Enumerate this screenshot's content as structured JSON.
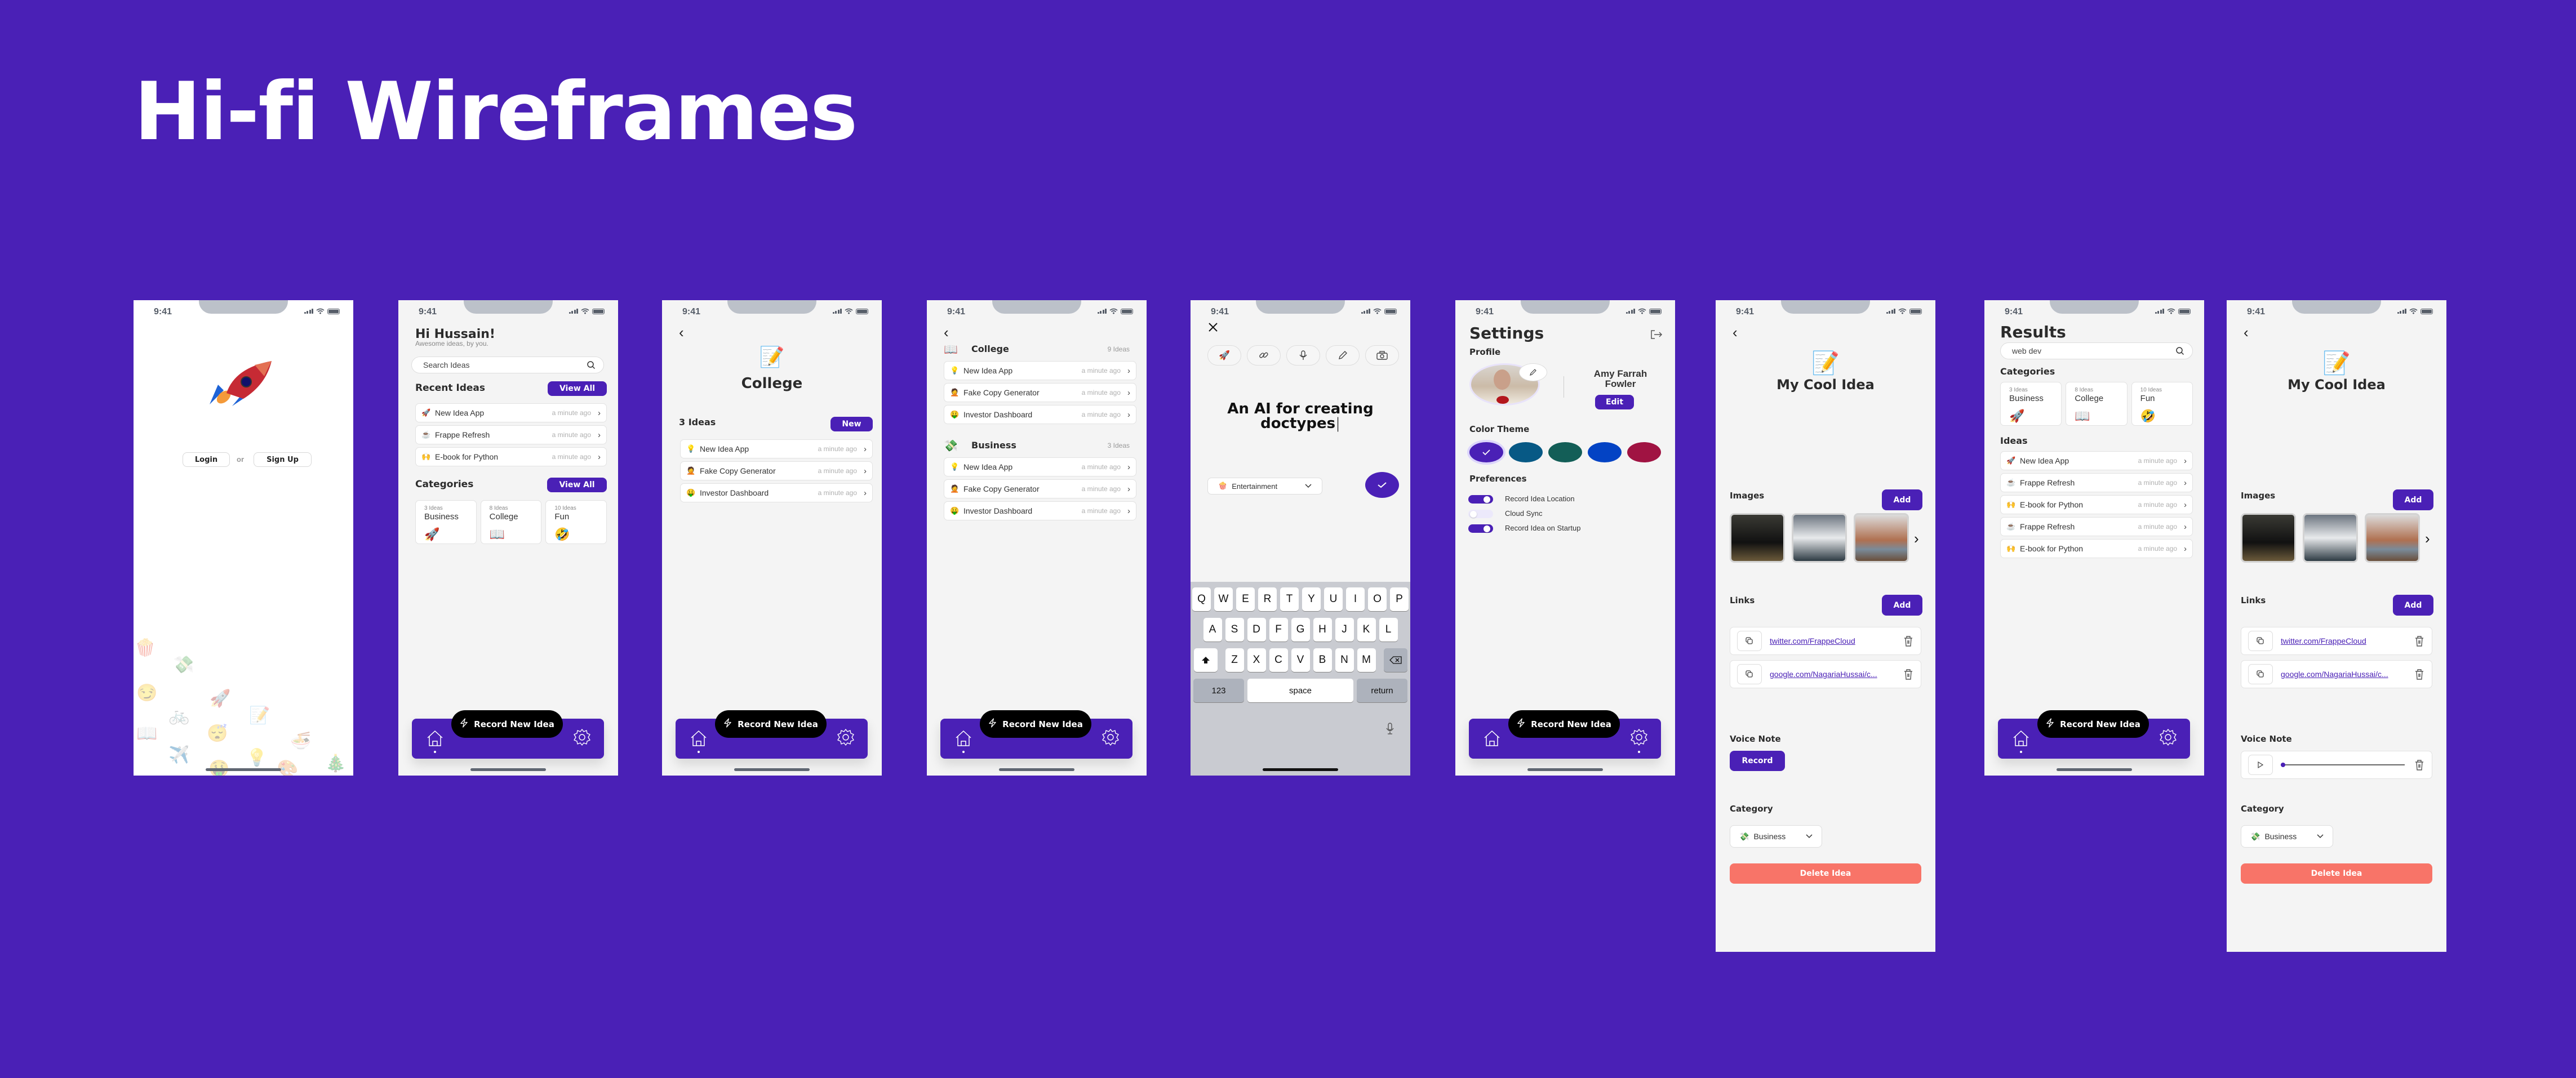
{
  "page_title": "Hi-fi Wireframes",
  "colors": {
    "background": "#4A20B6",
    "accent": "#4A20B6",
    "danger": "#F87468",
    "screen_bg": "#F4F4F4"
  },
  "status_bar": {
    "time": "9:41"
  },
  "nav": {
    "record_label": "Record New Idea",
    "home_icon": "home-icon",
    "settings_icon": "gear-icon",
    "bolt_icon": "lightning-icon"
  },
  "screen_welcome": {
    "hero_icon": "rocket-emoji",
    "login_label": "Login",
    "or_label": "or",
    "signup_label": "Sign Up",
    "background_emojis": [
      "🍿",
      "💸",
      "😏",
      "🚀",
      "🚲",
      "📝",
      "📖",
      "😴",
      "🍜",
      "✈️",
      "💡",
      "🎄",
      "🤑",
      "🎨"
    ]
  },
  "screen_home": {
    "greeting": "Hi Hussain!",
    "subtitle": "Awesome ideas, by you.",
    "search_placeholder": "Search Ideas",
    "recent_title": "Recent Ideas",
    "view_all_label": "View All",
    "recent": [
      {
        "emoji": "🚀",
        "name": "New Idea App",
        "time": "a minute ago"
      },
      {
        "emoji": "☕",
        "name": "Frappe Refresh",
        "time": "a minute ago"
      },
      {
        "emoji": "🙌",
        "name": "E-book for Python",
        "time": "a minute ago"
      }
    ],
    "categories_title": "Categories",
    "categories": [
      {
        "count": "3 Ideas",
        "name": "Business",
        "emoji": "🚀"
      },
      {
        "count": "8 Ideas",
        "name": "College",
        "emoji": "📖"
      },
      {
        "count": "10 Ideas",
        "name": "Fun",
        "emoji": "🤣"
      }
    ]
  },
  "screen_category": {
    "emoji": "📝",
    "title": "College",
    "count_label": "3 Ideas",
    "new_label": "New",
    "ideas": [
      {
        "emoji": "💡",
        "name": "New Idea App",
        "time": "a minute ago"
      },
      {
        "emoji": "🤦",
        "name": "Fake Copy Generator",
        "time": "a minute ago"
      },
      {
        "emoji": "🤑",
        "name": "Investor Dashboard",
        "time": "a minute ago"
      }
    ]
  },
  "screen_all_categories": {
    "groups": [
      {
        "emoji": "📖",
        "name": "College",
        "count": "9 Ideas",
        "ideas": [
          {
            "emoji": "💡",
            "name": "New Idea App",
            "time": "a minute ago"
          },
          {
            "emoji": "🤦",
            "name": "Fake Copy Generator",
            "time": "a minute ago"
          },
          {
            "emoji": "🤑",
            "name": "Investor Dashboard",
            "time": "a minute ago"
          }
        ]
      },
      {
        "emoji": "💸",
        "name": "Business",
        "count": "3 Ideas",
        "ideas": [
          {
            "emoji": "💡",
            "name": "New Idea App",
            "time": "a minute ago"
          },
          {
            "emoji": "🤦",
            "name": "Fake Copy Generator",
            "time": "a minute ago"
          },
          {
            "emoji": "🤑",
            "name": "Investor Dashboard",
            "time": "a minute ago"
          }
        ]
      }
    ]
  },
  "screen_new_idea": {
    "tools": [
      "rocket-emoji",
      "link-icon",
      "microphone-icon",
      "pencil-icon",
      "camera-icon"
    ],
    "idea_text": "An AI for creating doctypes",
    "category_emoji": "🍿",
    "category_value": "Entertainment",
    "keyboard": {
      "row1": [
        "Q",
        "W",
        "E",
        "R",
        "T",
        "Y",
        "U",
        "I",
        "O",
        "P"
      ],
      "row2": [
        "A",
        "S",
        "D",
        "F",
        "G",
        "H",
        "J",
        "K",
        "L"
      ],
      "row3": [
        "Z",
        "X",
        "C",
        "V",
        "B",
        "N",
        "M"
      ],
      "numbers_label": "123",
      "space_label": "space",
      "return_label": "return"
    }
  },
  "screen_settings": {
    "title": "Settings",
    "profile_title": "Profile",
    "user_name": "Amy Farrah Fowler",
    "edit_label": "Edit",
    "theme_title": "Color Theme",
    "theme_colors": [
      "#4A20B6",
      "#075985",
      "#135E57",
      "#0343C4",
      "#A01342"
    ],
    "selected_theme": 0,
    "preferences_title": "Preferences",
    "preferences": [
      {
        "label": "Record Idea Location",
        "enabled": true
      },
      {
        "label": "Cloud Sync",
        "enabled": false
      },
      {
        "label": "Record Idea on Startup",
        "enabled": true
      }
    ]
  },
  "screen_idea_detail": {
    "emoji": "📝",
    "title": "My Cool Idea",
    "images_title": "Images",
    "add_label": "Add",
    "links_title": "Links",
    "links": [
      "twitter.com/FrappeCloud",
      "google.com/NagariaHussai/c..."
    ],
    "voice_title": "Voice Note",
    "record_label": "Record",
    "category_title": "Category",
    "category_emoji": "💸",
    "category_value": "Business",
    "delete_label": "Delete Idea"
  },
  "screen_results": {
    "title": "Results",
    "search_value": "web dev",
    "categories_title": "Categories",
    "categories": [
      {
        "count": "3 Ideas",
        "name": "Business",
        "emoji": "🚀"
      },
      {
        "count": "8 Ideas",
        "name": "College",
        "emoji": "📖"
      },
      {
        "count": "10 Ideas",
        "name": "Fun",
        "emoji": "🤣"
      }
    ],
    "ideas_title": "Ideas",
    "ideas": [
      {
        "emoji": "🚀",
        "name": "New Idea App",
        "time": "a minute ago"
      },
      {
        "emoji": "☕",
        "name": "Frappe Refresh",
        "time": "a minute ago"
      },
      {
        "emoji": "🙌",
        "name": "E-book for Python",
        "time": "a minute ago"
      },
      {
        "emoji": "☕",
        "name": "Frappe Refresh",
        "time": "a minute ago"
      },
      {
        "emoji": "🙌",
        "name": "E-book for Python",
        "time": "a minute ago"
      }
    ]
  },
  "screen_idea_detail_voice": {
    "voice_progress": 0.0
  }
}
